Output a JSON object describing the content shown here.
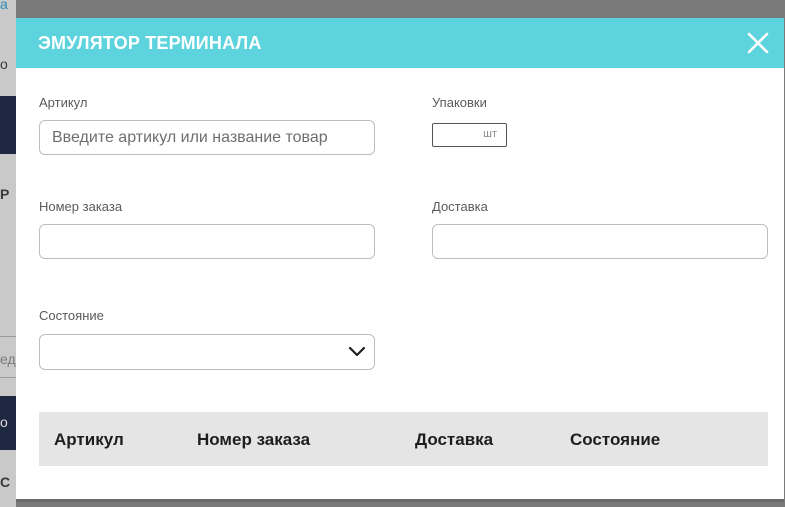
{
  "background": {
    "fragments": [
      "a",
      "o",
      "Р",
      "ед",
      "о",
      "С"
    ]
  },
  "modal": {
    "title": "ЭМУЛЯТОР ТЕРМИНАЛА",
    "close_icon": "close-x",
    "accent_color": "#5dd3dd"
  },
  "form": {
    "article": {
      "label": "Артикул",
      "placeholder": "Введите артикул или название товар",
      "value": ""
    },
    "packages": {
      "label": "Упаковки",
      "value": "",
      "unit": "шт"
    },
    "order_number": {
      "label": "Номер заказа",
      "value": ""
    },
    "delivery": {
      "label": "Доставка",
      "value": ""
    },
    "state": {
      "label": "Состояние",
      "selected": "",
      "icon": "chevron-down"
    }
  },
  "table": {
    "columns": [
      "Артикул",
      "Номер заказа",
      "Доставка",
      "Состояние"
    ],
    "rows": []
  }
}
